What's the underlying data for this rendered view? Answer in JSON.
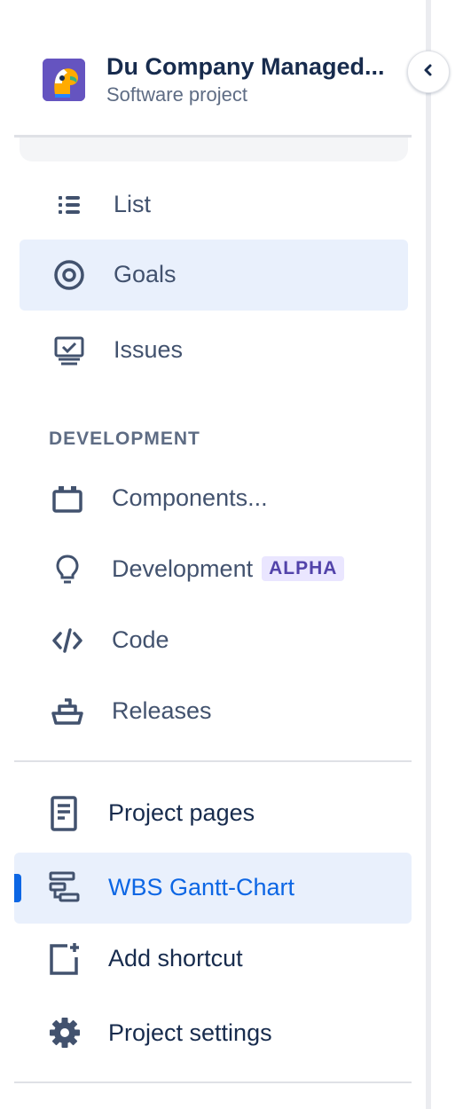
{
  "project": {
    "name": "Du Company Managed...",
    "type": "Software project",
    "avatar_icon": "parrot-avatar-icon"
  },
  "collapse_icon": "chevron-left-icon",
  "planning": [
    {
      "label": "List",
      "icon": "list-icon",
      "selected": false
    },
    {
      "label": "Goals",
      "icon": "target-icon",
      "selected": true
    },
    {
      "label": "Issues",
      "icon": "issues-icon",
      "selected": false
    }
  ],
  "development": {
    "title": "DEVELOPMENT",
    "items": [
      {
        "label": "Components...",
        "icon": "components-icon"
      },
      {
        "label": "Development",
        "icon": "lightbulb-icon",
        "badge": "ALPHA"
      },
      {
        "label": "Code",
        "icon": "code-icon"
      },
      {
        "label": "Releases",
        "icon": "ship-icon"
      }
    ]
  },
  "shortcuts": [
    {
      "label": "Project pages",
      "icon": "page-icon",
      "selected": false
    },
    {
      "label": "WBS Gantt-Chart",
      "icon": "gantt-icon",
      "selected": true
    },
    {
      "label": "Add shortcut",
      "icon": "add-shortcut-icon",
      "selected": false
    },
    {
      "label": "Project settings",
      "icon": "gear-icon",
      "selected": false
    }
  ],
  "colors": {
    "accent": "#0c66e4",
    "selected_bg": "#e9f0fc",
    "text": "#42526e",
    "heading": "#172b4d",
    "badge_bg": "#eae6ff",
    "badge_text": "#5243aa"
  }
}
